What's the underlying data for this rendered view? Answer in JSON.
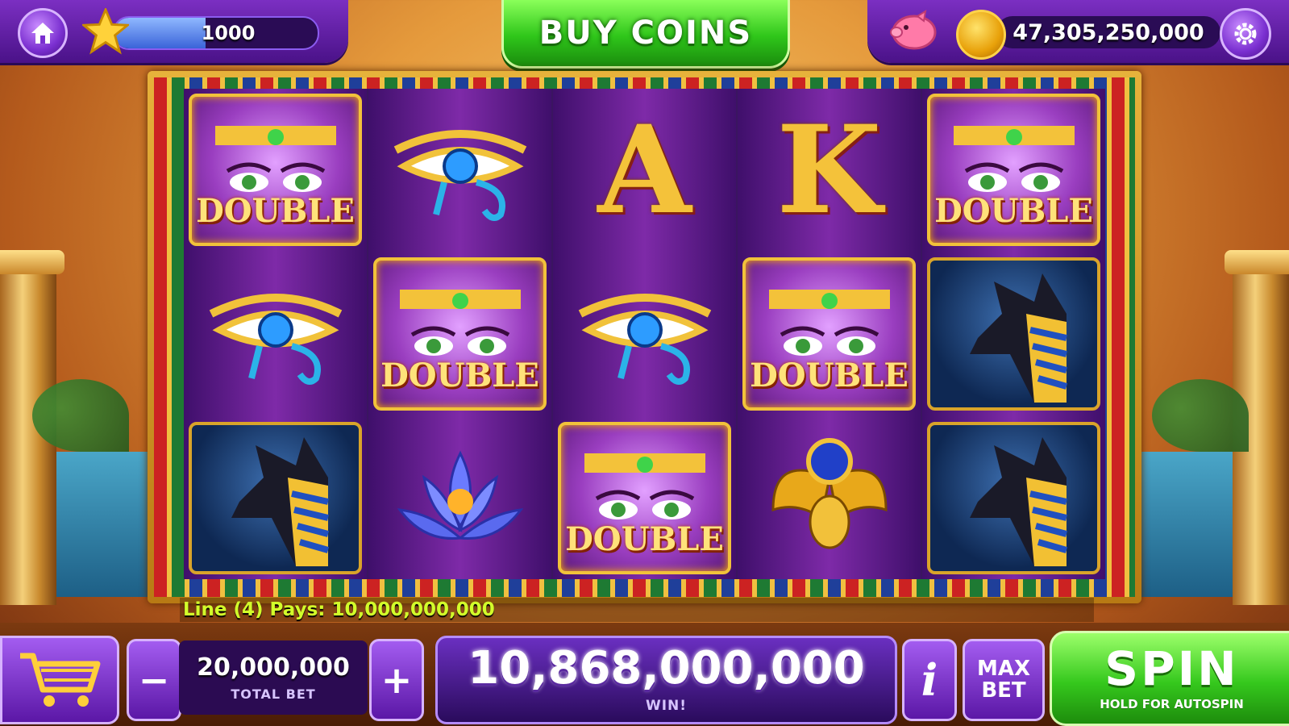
{
  "top_bar": {
    "level_xp": "1000",
    "xp_progress": 0.45,
    "buy_coins_label": "BUY COINS",
    "coin_balance": "47,305,250,000"
  },
  "reels": [
    [
      "double",
      "eye-of-horus",
      "anubis"
    ],
    [
      "eye-of-horus",
      "double",
      "lotus"
    ],
    [
      "letter-a",
      "eye-of-horus",
      "double"
    ],
    [
      "letter-k",
      "double",
      "scarab"
    ],
    [
      "double",
      "anubis",
      "anubis"
    ]
  ],
  "symbols": {
    "double_label": "DOUBLE",
    "letter_a": "A",
    "letter_k": "K"
  },
  "payline_message": "Line (4) Pays: 10,000,000,000",
  "bottom_bar": {
    "total_bet_value": "20,000,000",
    "total_bet_label": "TOTAL BET",
    "minus_label": "−",
    "plus_label": "+",
    "win_value": "10,868,000,000",
    "win_label": "WIN!",
    "info_label": "i",
    "max_bet_label": "MAX BET",
    "spin_label": "SPIN",
    "spin_sub_label": "HOLD FOR AUTOSPIN"
  },
  "colors": {
    "accent_purple": "#7b2fc2",
    "spin_green": "#35c81d",
    "payline_text": "#d2ff2a"
  }
}
